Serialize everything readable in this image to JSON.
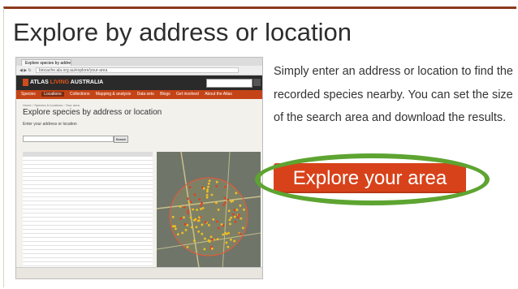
{
  "heading": "Explore by address or location",
  "description": "Simply enter an address or location to find the recorded species nearby. You can set the size of the search area and download the results.",
  "cta_label": "Explore your area",
  "colors": {
    "accent": "#d8421a",
    "ring": "#5da431",
    "border": "#8b3a1e"
  },
  "thumbnail": {
    "tab_label": "Explore species by address or location",
    "url": "biocache.ala.org.au/explore/your-area",
    "logo_prefix": "ATLAS",
    "logo_mid": "LIVING",
    "logo_suffix": "AUSTRALIA",
    "menu": [
      "Species",
      "Locations",
      "Collections",
      "Mapping & analysis",
      "Data sets",
      "Blogs",
      "Get involved",
      "About the Atlas"
    ],
    "breadcrumb": "Home › Species & locations › Your area",
    "title": "Explore species by address or location",
    "subtitle": "Enter your address or location",
    "search_button": "Search"
  }
}
